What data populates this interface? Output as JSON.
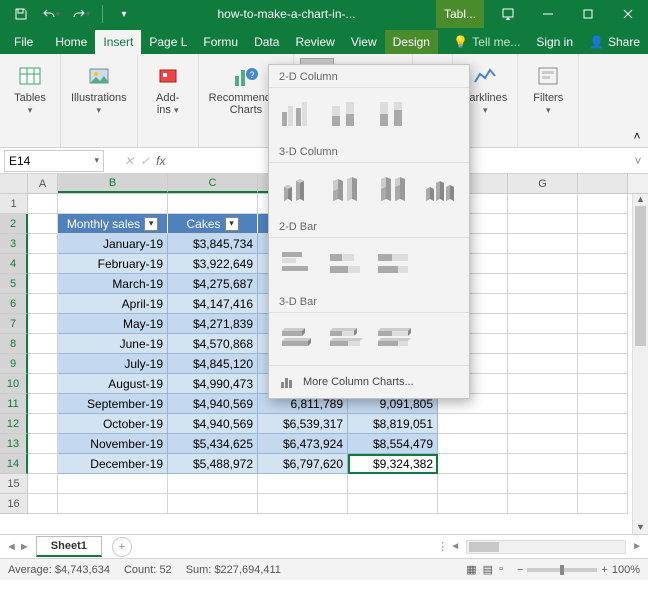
{
  "titlebar": {
    "filename": "how-to-make-a-chart-in-...",
    "context_tab": "Tabl..."
  },
  "tabs": {
    "file": "File",
    "home": "Home",
    "insert": "Insert",
    "pagel": "Page L",
    "formu": "Formu",
    "data": "Data",
    "review": "Review",
    "view": "View",
    "design": "Design",
    "tell": "Tell me...",
    "signin": "Sign in",
    "share": "Share"
  },
  "ribbon": {
    "tables": "Tables",
    "illustrations": "Illustrations",
    "addins": "Add-\nins",
    "recommended": "Recommended\nCharts",
    "sparklines": "parklines",
    "filters": "Filters"
  },
  "namebox": {
    "value": "E14"
  },
  "columns": [
    "A",
    "B",
    "C",
    "G"
  ],
  "chart_dropdown": {
    "s1": "2-D Column",
    "s2": "3-D Column",
    "s3": "2-D Bar",
    "s4": "3-D Bar",
    "more": "More Column Charts..."
  },
  "table": {
    "headers": {
      "b": "Monthly sales",
      "c": "Cakes"
    },
    "rows": [
      {
        "b": "January-19",
        "c": "$3,845,734"
      },
      {
        "b": "February-19",
        "c": "$3,922,649"
      },
      {
        "b": "March-19",
        "c": "$4,275,687"
      },
      {
        "b": "April-19",
        "c": "$4,147,416"
      },
      {
        "b": "May-19",
        "c": "$4,271,839"
      },
      {
        "b": "June-19",
        "c": "$4,570,868"
      },
      {
        "b": "July-19",
        "c": "$4,845,120"
      },
      {
        "b": "August-19",
        "c": "$4,990,473"
      },
      {
        "b": "September-19",
        "c": "$4,940,569",
        "d": "6,811,789",
        "e": "9,091,805"
      },
      {
        "b": "October-19",
        "c": "$4,940,569",
        "d": "$6,539,317",
        "e": "$8,819,051"
      },
      {
        "b": "November-19",
        "c": "$5,434,625",
        "d": "$6,473,924",
        "e": "$8,554,479"
      },
      {
        "b": "December-19",
        "c": "$5,488,972",
        "d": "$6,797,620",
        "e": "$9,324,382"
      }
    ]
  },
  "sheet": {
    "name": "Sheet1"
  },
  "status": {
    "average_label": "Average:",
    "average_value": "$4,743,634",
    "count_label": "Count:",
    "count_value": "52",
    "sum_label": "Sum:",
    "sum_value": "$227,694,411",
    "zoom": "100%"
  }
}
